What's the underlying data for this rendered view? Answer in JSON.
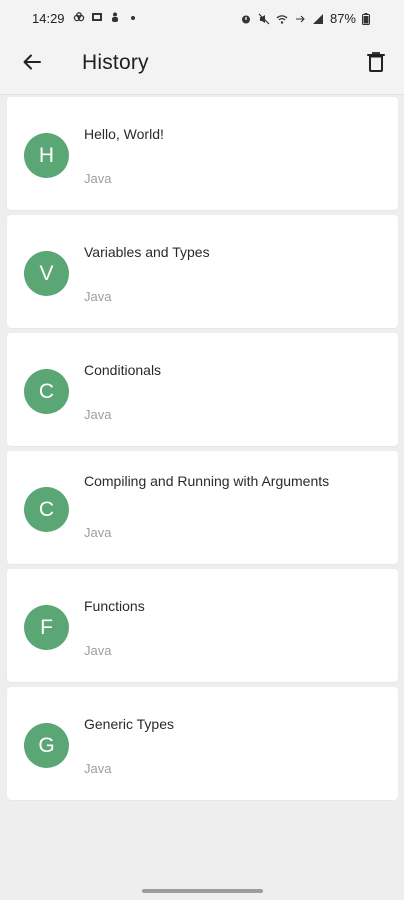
{
  "status_bar": {
    "time": "14:29",
    "battery": "87%"
  },
  "app_bar": {
    "title": "History"
  },
  "colors": {
    "avatar": "#5aa675",
    "background": "#eeeeef"
  },
  "history": [
    {
      "initial": "H",
      "title": "Hello, World!",
      "language": "Java"
    },
    {
      "initial": "V",
      "title": "Variables and Types",
      "language": "Java"
    },
    {
      "initial": "C",
      "title": "Conditionals",
      "language": "Java"
    },
    {
      "initial": "C",
      "title": "Compiling and Running with Arguments",
      "language": "Java"
    },
    {
      "initial": "F",
      "title": "Functions",
      "language": "Java"
    },
    {
      "initial": "G",
      "title": "Generic Types",
      "language": "Java"
    }
  ]
}
